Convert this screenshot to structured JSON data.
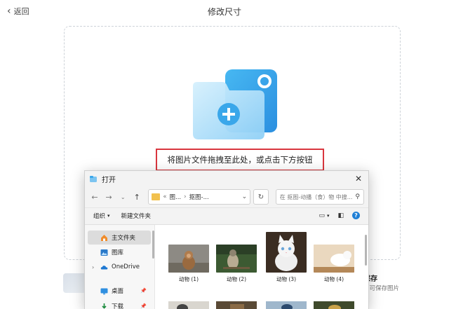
{
  "header": {
    "back_label": "返回",
    "title": "修改尺寸"
  },
  "dropzone": {
    "hint": "将图片文件拖拽至此处，或点击下方按钮"
  },
  "footer": {
    "save_text": "保存",
    "save_sub": "即可保存图片"
  },
  "dialog": {
    "title": "打开",
    "close": "✕",
    "address": {
      "part1": "图...",
      "part2": "抠图-..."
    },
    "search_placeholder": "在 抠图-动播（食）物 中搜...",
    "toolbar": {
      "organize": "组织",
      "new_folder": "新建文件夹"
    },
    "sidebar": [
      {
        "label": "主文件夹",
        "active": true
      },
      {
        "label": "图库",
        "active": false
      },
      {
        "label": "OneDrive",
        "active": false
      },
      {
        "label": "桌面",
        "active": false
      },
      {
        "label": "下载",
        "active": false
      }
    ],
    "files": [
      {
        "name": "动物 (1)"
      },
      {
        "name": "动物 (2)"
      },
      {
        "name": "动物 (3)"
      },
      {
        "name": "动物 (4)"
      }
    ]
  },
  "colors": {
    "accent": "#1f7fd6",
    "hint_border": "#d9363e",
    "folder_light": "#a8dcf8",
    "folder_dark": "#3aa7ea"
  }
}
